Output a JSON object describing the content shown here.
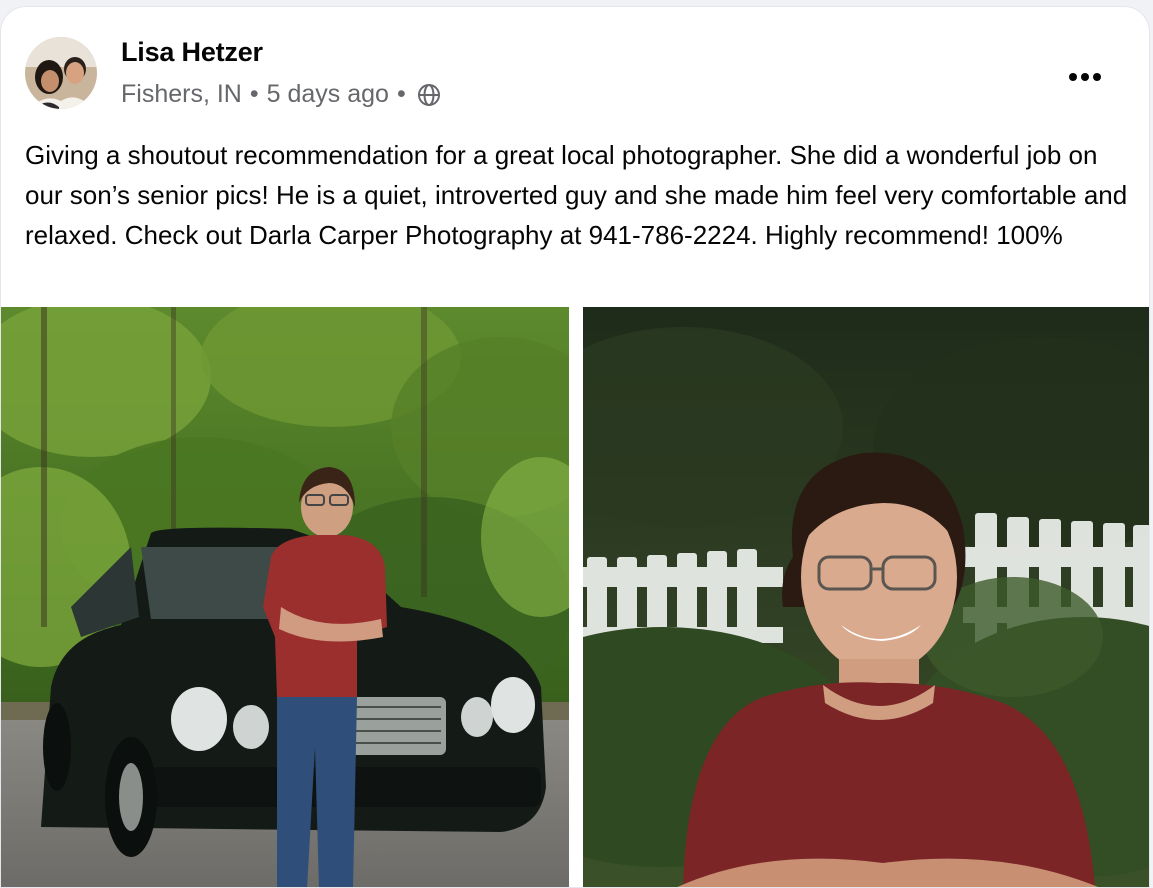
{
  "post": {
    "author": "Lisa Hetzer",
    "location": "Fishers, IN",
    "separator": "•",
    "time": "5 days ago",
    "audience_icon": "globe-icon",
    "more_icon": "more-options-icon",
    "text": "Giving a shoutout recommendation for a great local photographer. She did a wonderful job on our son’s senior pics! He is a quiet, introverted guy and she made him feel very comfortable and relaxed. Check out Darla Carper Photography at 941-786-2224. Highly recommend! 100%"
  },
  "photos": [
    {
      "name": "photo-car"
    },
    {
      "name": "photo-portrait"
    }
  ],
  "colors": {
    "text_primary": "#050505",
    "text_secondary": "#65676b",
    "card_bg": "#ffffff"
  }
}
